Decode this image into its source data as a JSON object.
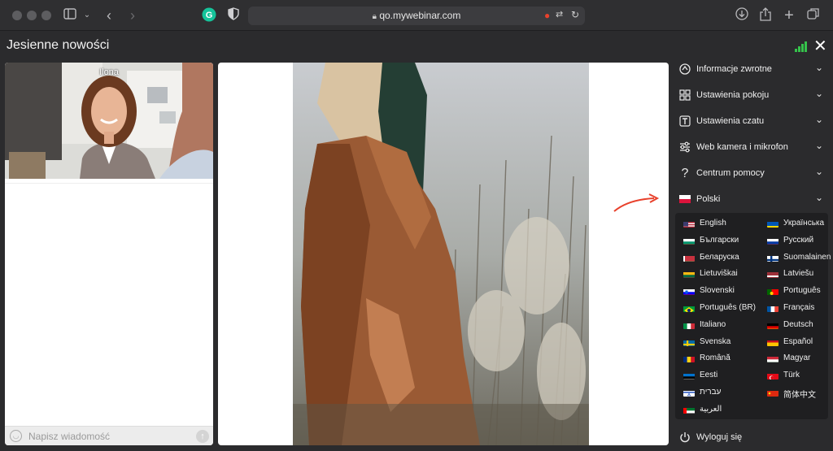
{
  "browser": {
    "url": "qo.mywebinar.com",
    "extension_badge": "G"
  },
  "room": {
    "title": "Jesienne nowości"
  },
  "participant": {
    "name": "Ilona"
  },
  "chat": {
    "placeholder": "Napisz wiadomość"
  },
  "menu": {
    "items": [
      {
        "label": "Informacje zwrotne",
        "icon": "feedback-icon"
      },
      {
        "label": "Ustawienia pokoju",
        "icon": "room-settings-icon"
      },
      {
        "label": "Ustawienia czatu",
        "icon": "chat-settings-icon"
      },
      {
        "label": "Web kamera i mikrofon",
        "icon": "sliders-icon"
      },
      {
        "label": "Centrum pomocy",
        "icon": "question-icon"
      },
      {
        "label": "Polski",
        "icon": "flag-pl-icon"
      }
    ],
    "logout": "Wyloguj się"
  },
  "languages": [
    {
      "name": "English",
      "flag": "us"
    },
    {
      "name": "Українська",
      "flag": "ua"
    },
    {
      "name": "Български",
      "flag": "bg"
    },
    {
      "name": "Русский",
      "flag": "ru"
    },
    {
      "name": "Беларуска",
      "flag": "by"
    },
    {
      "name": "Suomalainen",
      "flag": "fi"
    },
    {
      "name": "Lietuviškai",
      "flag": "lt"
    },
    {
      "name": "Latviešu",
      "flag": "lv"
    },
    {
      "name": "Slovenski",
      "flag": "si"
    },
    {
      "name": "Português",
      "flag": "pt"
    },
    {
      "name": "Português (BR)",
      "flag": "br"
    },
    {
      "name": "Français",
      "flag": "fr"
    },
    {
      "name": "Italiano",
      "flag": "it"
    },
    {
      "name": "Deutsch",
      "flag": "de"
    },
    {
      "name": "Svenska",
      "flag": "se"
    },
    {
      "name": "Español",
      "flag": "es"
    },
    {
      "name": "Română",
      "flag": "ro"
    },
    {
      "name": "Magyar",
      "flag": "hu"
    },
    {
      "name": "Eesti",
      "flag": "ee"
    },
    {
      "name": "Türk",
      "flag": "tr"
    },
    {
      "name": "עברית",
      "flag": "il"
    },
    {
      "name": "简体中文",
      "flag": "cn"
    },
    {
      "name": "العربية",
      "flag": "ae"
    }
  ],
  "colors": {
    "accent_arrow": "#e8412c",
    "signal": "#35c24b",
    "panel_bg": "#2b2b2d"
  }
}
